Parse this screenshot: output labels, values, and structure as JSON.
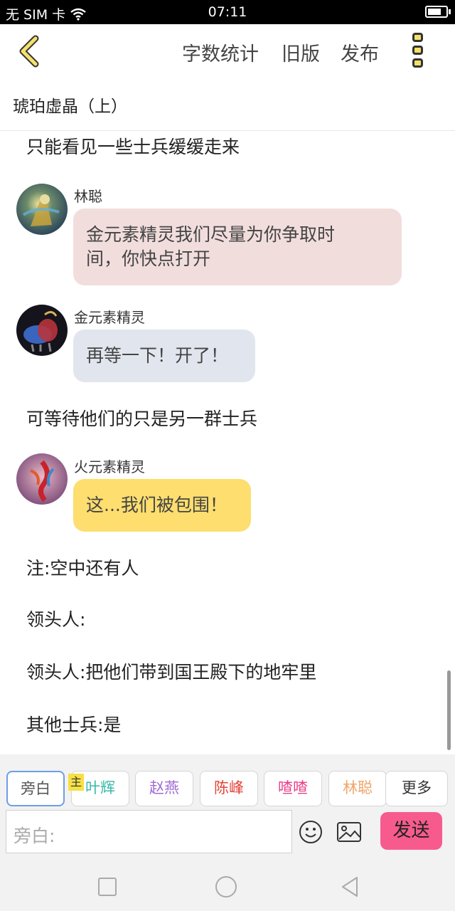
{
  "status_bar": {
    "carrier": "无 SIM 卡",
    "time": "07:11"
  },
  "header": {
    "actions": [
      "字数统计",
      "旧版",
      "发布"
    ],
    "doc_title": "琥珀虚晶（上）"
  },
  "messages": {
    "narration_1": "只能看见一些士兵缓缓走来",
    "msg1": {
      "speaker": "林聪",
      "line1": "金元素精灵我们尽量为你争取时",
      "line2": "间，你快点打开",
      "color": "#f2dddd"
    },
    "msg2": {
      "speaker": "金元素精灵",
      "text": "再等一下！开了！",
      "color": "#e1e6ee"
    },
    "narration_2": "可等待他们的只是另一群士兵",
    "msg3": {
      "speaker": "火元素精灵",
      "text": "这...我们被包围！",
      "color": "#fdde6e"
    },
    "narration_3": "注:空中还有人",
    "narration_4": "领头人:",
    "narration_5": "领头人:把他们带到国王殿下的地牢里",
    "narration_6": "其他士兵:是"
  },
  "roles": [
    {
      "label": "旁白",
      "color": "#555555"
    },
    {
      "label": "叶辉",
      "color": "#39b8a8"
    },
    {
      "label": "赵燕",
      "color": "#a06ad2"
    },
    {
      "label": "陈峰",
      "color": "#e2453a"
    },
    {
      "label": "喳喳",
      "color": "#e8418a"
    },
    {
      "label": "林聪",
      "color": "#f0a56a"
    },
    {
      "label": "更多",
      "color": "#333333"
    }
  ],
  "host_badge": "主",
  "input": {
    "placeholder": "旁白:"
  },
  "send_label": "发送",
  "colors": {
    "accent": "#f75b8e",
    "back_arrow": "#f6e06a"
  }
}
